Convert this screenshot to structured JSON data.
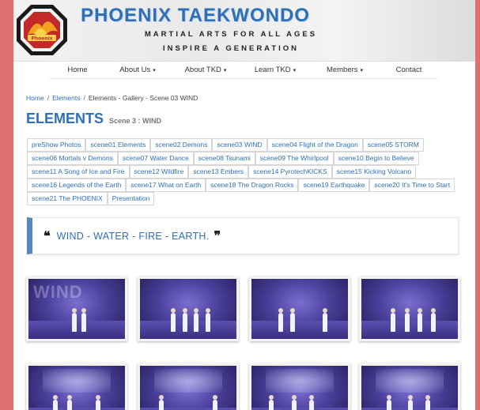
{
  "site": {
    "title": "PHOENIX TAEKWONDO",
    "tagline1": "MARTIAL ARTS FOR ALL AGES",
    "tagline2": "INSPIRE A GENERATION",
    "logo_text": "Phoenix"
  },
  "nav": {
    "items": [
      {
        "label": "Home",
        "dropdown": false
      },
      {
        "label": "About Us",
        "dropdown": true
      },
      {
        "label": "About TKD",
        "dropdown": true
      },
      {
        "label": "Learn TKD",
        "dropdown": true
      },
      {
        "label": "Members",
        "dropdown": true
      },
      {
        "label": "Contact",
        "dropdown": false
      }
    ],
    "caret": "▾"
  },
  "breadcrumb": {
    "home": "Home",
    "sep": "/",
    "elements": "Elements",
    "current": "Elements - Gallery - Scene 03 WIND"
  },
  "heading": {
    "title": "ELEMENTS",
    "subtitle": "Scene 3 : WIND"
  },
  "scene_links": [
    "preShow Photos",
    "scene01 Elements",
    "scene02 Demons",
    "scene03 WIND",
    "scene04 Flight of the Dragon",
    "scene05 STORM",
    "scene06 Mortals v Demons",
    "scene07 Water Dance",
    "scene08 Tsunami",
    "scene09 The Whirlpool",
    "scene10 Begin to Believe",
    "scene11 A Song of Ice and Fire",
    "scene12 Wildfire",
    "scene13 Embers",
    "scene14 PyrotechKICKS",
    "scene15 Kicking Volcano",
    "scene16 Legends of the Earth",
    "scene17 What on Earth",
    "scene18 The Dragon Rocks",
    "scene19 Earthquake",
    "scene20 It's Time to Start",
    "scene21 The PHOENIX",
    "Presentation"
  ],
  "quote": {
    "open": "❝",
    "text": "WIND - WATER - FIRE - EARTH.",
    "close": "❞"
  },
  "gallery": {
    "first_overlay": "WIND",
    "photo_count_visible": 8
  },
  "colors": {
    "outer_border": "#e07070",
    "brand_blue": "#2f6fb5",
    "quote_bar": "#5588bb"
  }
}
